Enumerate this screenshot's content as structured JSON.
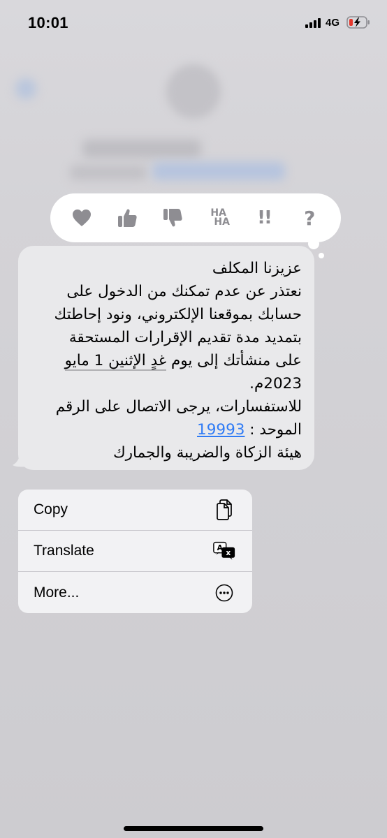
{
  "status_bar": {
    "time": "10:01",
    "network": "4G",
    "battery_state": "low-charging"
  },
  "reactions": [
    {
      "name": "heart-icon",
      "label": ""
    },
    {
      "name": "thumbs-up-icon",
      "label": ""
    },
    {
      "name": "thumbs-down-icon",
      "label": ""
    },
    {
      "name": "haha-icon",
      "label_1": "HA",
      "label_2": "HA"
    },
    {
      "name": "exclamation-icon",
      "label": "!!"
    },
    {
      "name": "question-icon",
      "label": "?"
    }
  ],
  "message": {
    "line1": "عزيزنا المكلف",
    "line2": "نعتذر عن عدم تمكنك من الدخول على",
    "line3": "حسابك بموقعنا الإلكتروني، ونود إحاطتك",
    "line4": "بتمديد مدة تقديم الإقرارات المستحقة",
    "line5_start": "على منشأتك إلى يوم ",
    "line5_date": "غدٍ الإثنين 1 مايو",
    "line6": "2023م.",
    "line7": "للاستفسارات، يرجى الاتصال على الرقم",
    "line8_prefix": "الموحد : ",
    "line8_number": "19993",
    "line9": "هيئة الزكاة والضريبة والجمارك"
  },
  "menu": {
    "items": [
      {
        "label": "Copy",
        "icon": "copy-icon"
      },
      {
        "label": "Translate",
        "icon": "translate-icon"
      },
      {
        "label": "More...",
        "icon": "more-icon"
      }
    ]
  },
  "colors": {
    "link": "#2f7bf5",
    "bubble": "#e9e9eb",
    "battery_low": "#e5382d"
  }
}
